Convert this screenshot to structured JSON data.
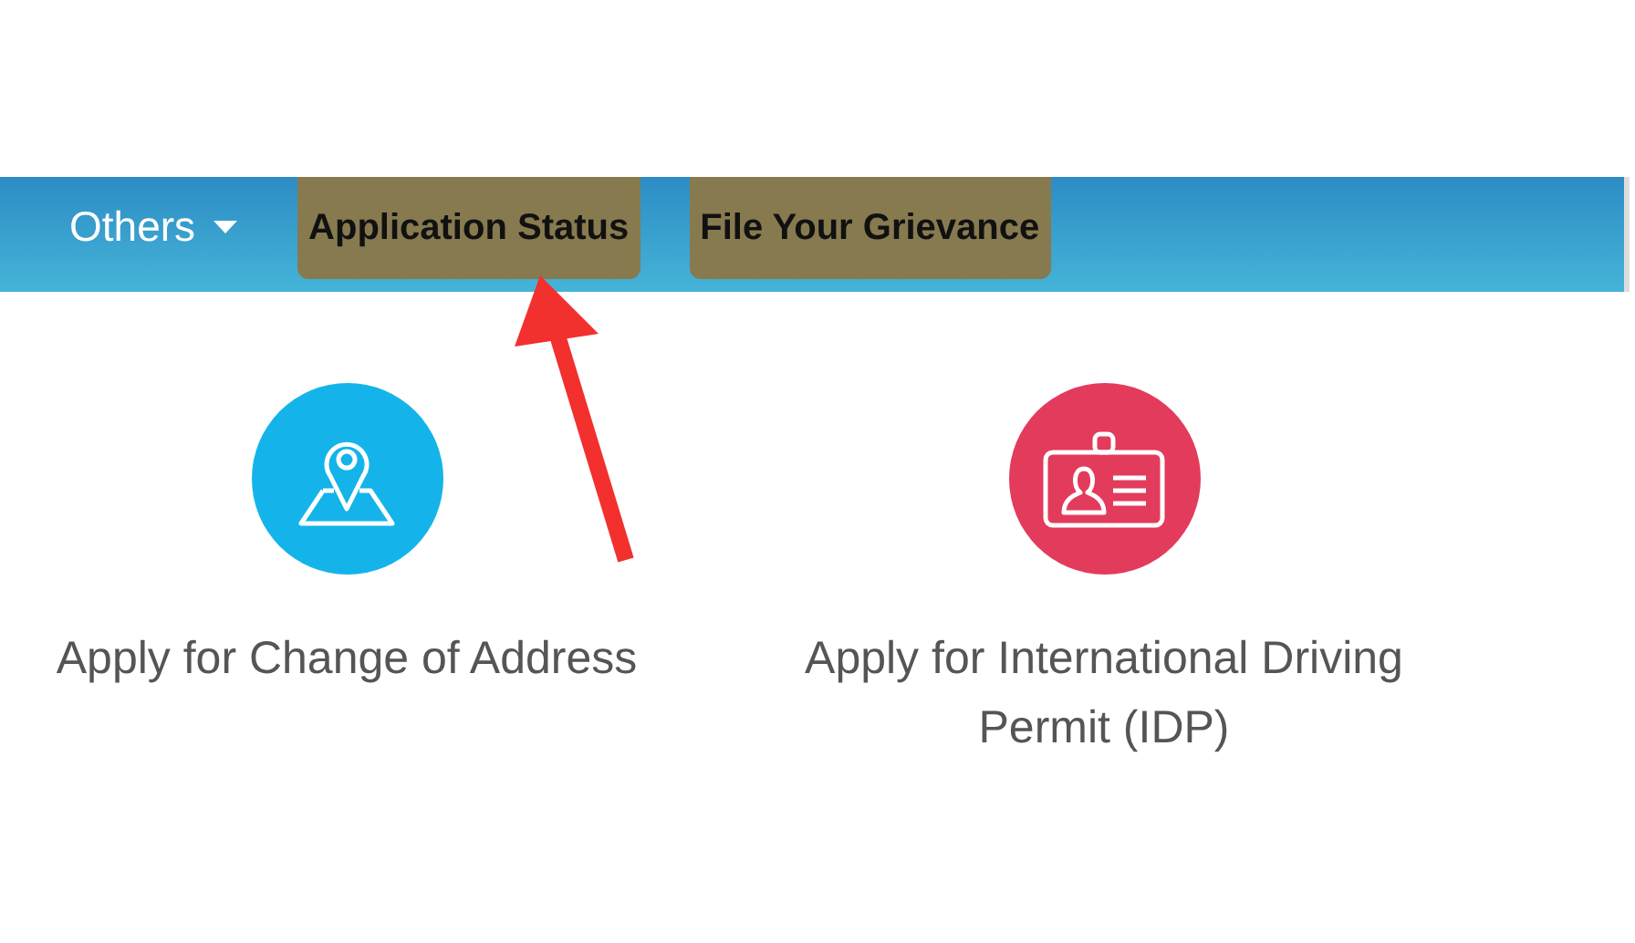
{
  "nav": {
    "items": [
      {
        "label": "Others",
        "kind": "dropdown"
      },
      {
        "label": "Application Status",
        "kind": "button"
      },
      {
        "label": "File Your Grievance",
        "kind": "button"
      }
    ]
  },
  "services": [
    {
      "label": "Apply for Change of Address",
      "kind": "location",
      "color": "#14b4ea"
    },
    {
      "label": "Apply for International Driving Permit (IDP)",
      "kind": "id-card",
      "color": "#e33b5c"
    }
  ]
}
